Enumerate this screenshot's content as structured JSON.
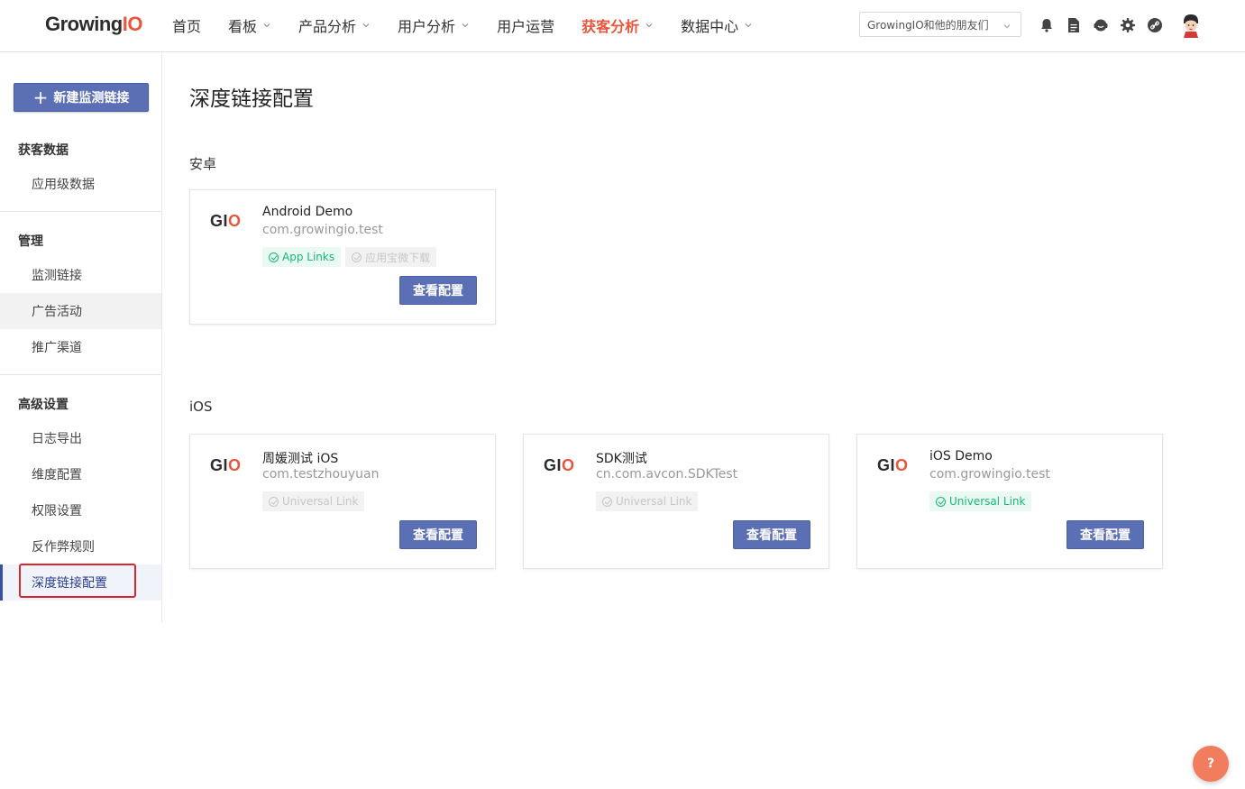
{
  "header": {
    "logo_main": "Growing",
    "logo_accent": "IO",
    "nav": [
      {
        "label": "首页",
        "dropdown": false,
        "active": false
      },
      {
        "label": "看板",
        "dropdown": true,
        "active": false
      },
      {
        "label": "产品分析",
        "dropdown": true,
        "active": false
      },
      {
        "label": "用户分析",
        "dropdown": true,
        "active": false
      },
      {
        "label": "用户运营",
        "dropdown": false,
        "active": false
      },
      {
        "label": "获客分析",
        "dropdown": true,
        "active": true
      },
      {
        "label": "数据中心",
        "dropdown": true,
        "active": false
      }
    ],
    "project_select": "GrowingIO和他的朋友们",
    "icons": [
      "bell-icon",
      "document-icon",
      "support-icon",
      "gear-icon",
      "link-icon"
    ]
  },
  "sidebar": {
    "new_button": "新建监测链接",
    "sections": [
      {
        "title": "获客数据",
        "items": [
          "应用级数据"
        ]
      },
      {
        "title": "管理",
        "items": [
          "监测链接",
          "广告活动",
          "推广渠道"
        ]
      },
      {
        "title": "高级设置",
        "items": [
          "日志导出",
          "维度配置",
          "权限设置",
          "反作弊规则",
          "深度链接配置"
        ]
      }
    ]
  },
  "main": {
    "title": "深度链接配置",
    "groups": [
      {
        "title": "安卓",
        "cards": [
          {
            "logo_g": "G",
            "logo_i": "I",
            "logo_o": "O",
            "name": "Android Demo",
            "package": "com.growingio.test",
            "tags": [
              {
                "label": "App Links",
                "enabled": true
              },
              {
                "label": "应用宝微下载",
                "enabled": false
              }
            ],
            "button": "查看配置"
          }
        ]
      },
      {
        "title": "iOS",
        "cards": [
          {
            "logo_g": "G",
            "logo_i": "I",
            "logo_o": "O",
            "name": "周媛测试 iOS",
            "package": "com.testzhouyuan",
            "tags": [
              {
                "label": "Universal Link",
                "enabled": false
              }
            ],
            "button": "查看配置"
          },
          {
            "logo_g": "G",
            "logo_i": "I",
            "logo_o": "O",
            "name": "SDK测试",
            "package": "cn.com.avcon.SDKTest",
            "tags": [
              {
                "label": "Universal Link",
                "enabled": false
              }
            ],
            "button": "查看配置"
          },
          {
            "logo_g": "G",
            "logo_i": "I",
            "logo_o": "O",
            "name": "iOS Demo",
            "package": "com.growingio.test",
            "tags": [
              {
                "label": "Universal Link",
                "enabled": true
              }
            ],
            "button": "查看配置"
          }
        ]
      }
    ]
  },
  "help_button": "?",
  "colors": {
    "accent": "#e8563e",
    "primary": "#5b6fb5",
    "success": "#17b77a"
  }
}
